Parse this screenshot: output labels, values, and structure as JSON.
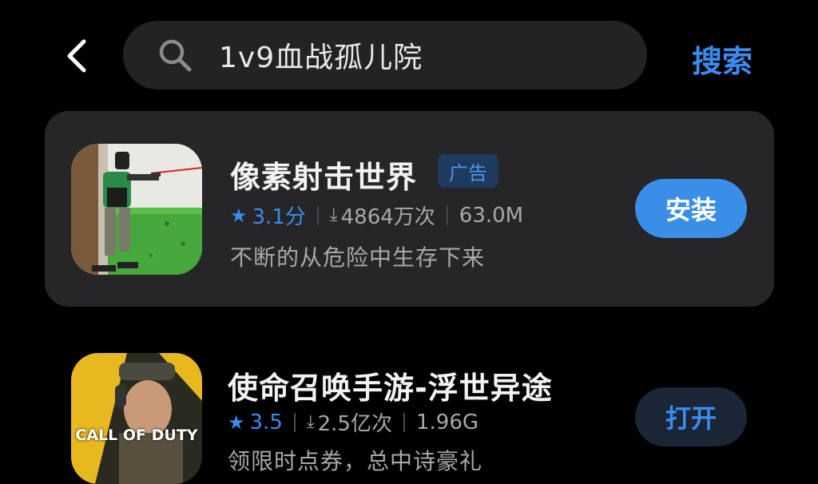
{
  "header": {
    "back_icon": "chevron-left-icon",
    "search_icon": "search-icon",
    "search_query": "1v9血战孤儿院",
    "search_button": "搜索"
  },
  "colors": {
    "accent": "#3b8cf0",
    "card_bg": "#262628",
    "search_bg": "#232325",
    "background": "#000000"
  },
  "apps": [
    {
      "name": "像素射击世界",
      "ad_label": "广告",
      "rating": "3.1分",
      "downloads": "4864万次",
      "size": "63.0M",
      "description": "不断的从危险中生存下来",
      "action": "安装"
    },
    {
      "name": "使命召唤手游-浮世异途",
      "rating": "3.5",
      "downloads": "2.5亿次",
      "size": "1.96G",
      "description": "领限时点券，总中诗豪礼",
      "action": "打开",
      "icon_logo_text": "CALL OF DUTY"
    }
  ]
}
